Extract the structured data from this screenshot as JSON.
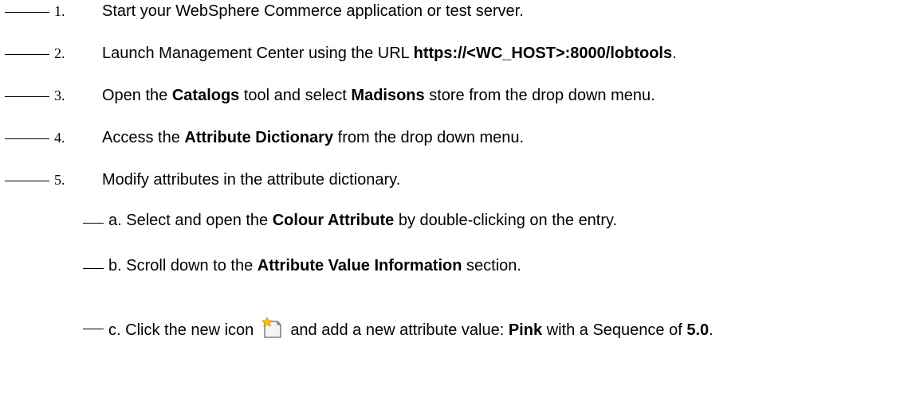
{
  "steps": [
    {
      "num": "1.",
      "parts": [
        "Start your WebSphere Commerce application or test server."
      ]
    },
    {
      "num": "2.",
      "parts": [
        "Launch Management Center using the URL ",
        "https://<WC_HOST>:8000/lobtools",
        "."
      ]
    },
    {
      "num": "3.",
      "parts": [
        "Open the ",
        "Catalogs",
        " tool and select ",
        "Madisons",
        " store from the drop down menu."
      ]
    },
    {
      "num": "4.",
      "parts": [
        "Access the ",
        "Attribute Dictionary",
        " from the drop down menu."
      ]
    },
    {
      "num": "5.",
      "parts": [
        "Modify attributes in the attribute dictionary."
      ]
    }
  ],
  "substeps": [
    {
      "letter": "a.",
      "parts": [
        "Select and open the ",
        "Colour Attribute",
        " by double-clicking on the entry."
      ]
    },
    {
      "letter": "b.",
      "parts": [
        "Scroll down to the ",
        "Attribute Value Information",
        " section."
      ]
    },
    {
      "letter": "c.",
      "parts": [
        "Click the new icon",
        "and add a new attribute value: ",
        "Pink",
        " with a Sequence of ",
        "5.0",
        "."
      ]
    }
  ],
  "icons": {
    "new": "new-document-icon"
  }
}
